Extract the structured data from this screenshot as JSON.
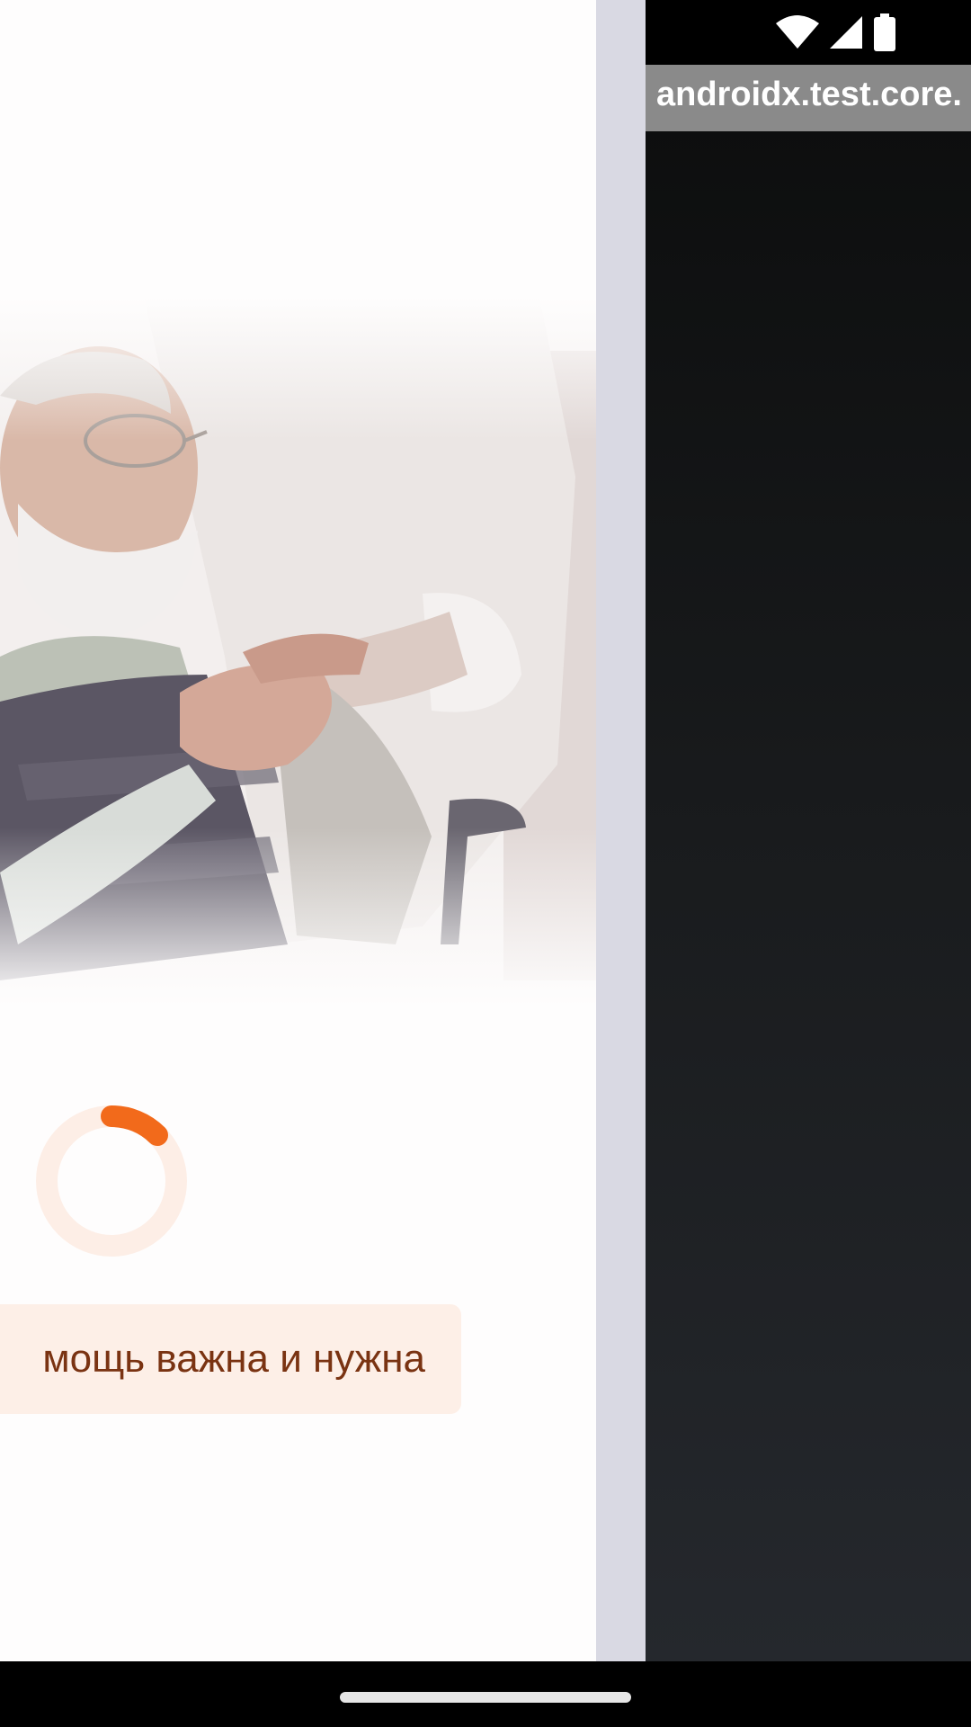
{
  "left_app": {
    "message": "мощь важна и нужна",
    "photo_alt": "elderly man in wheelchair with caregiver",
    "spinner": {
      "state": "loading"
    }
  },
  "right_app": {
    "title": "androidx.test.core.",
    "status_icons": [
      "wifi-icon",
      "cell-signal-icon",
      "battery-icon"
    ]
  },
  "colors": {
    "accent": "#f26a1b",
    "chip_bg": "#fdefe7",
    "chip_text": "#7a3312",
    "divider": "#d9d9e3",
    "title_bar": "#8a8a8a"
  }
}
